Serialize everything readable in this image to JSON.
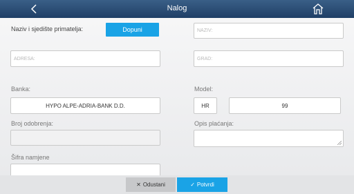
{
  "header": {
    "title": "Nalog",
    "back_icon": "chevron-left-icon",
    "home_icon": "home-icon"
  },
  "form": {
    "recipient_label": "Naziv i sjedište primatelja:",
    "fill_button": "Dopuni",
    "name_placeholder": "NAZIV:",
    "address_placeholder": "ADRESA:",
    "city_placeholder": "GRAD:",
    "bank_label": "Banka:",
    "bank_value": "HYPO ALPE-ADRIA-BANK D.D.",
    "model_label": "Model:",
    "model_country": "HR",
    "model_value": "99",
    "approval_label": "Broj odobrenja:",
    "approval_value": "",
    "description_label": "Opis plaćanja:",
    "description_value": "",
    "purpose_label": "Šifra namjene",
    "purpose_value": ""
  },
  "footer": {
    "cancel_label": "Odustani",
    "confirm_label": "Potvrdi"
  },
  "colors": {
    "header": "#2b4e77",
    "accent": "#1aa3e6",
    "cancel": "#c7c8ca"
  }
}
